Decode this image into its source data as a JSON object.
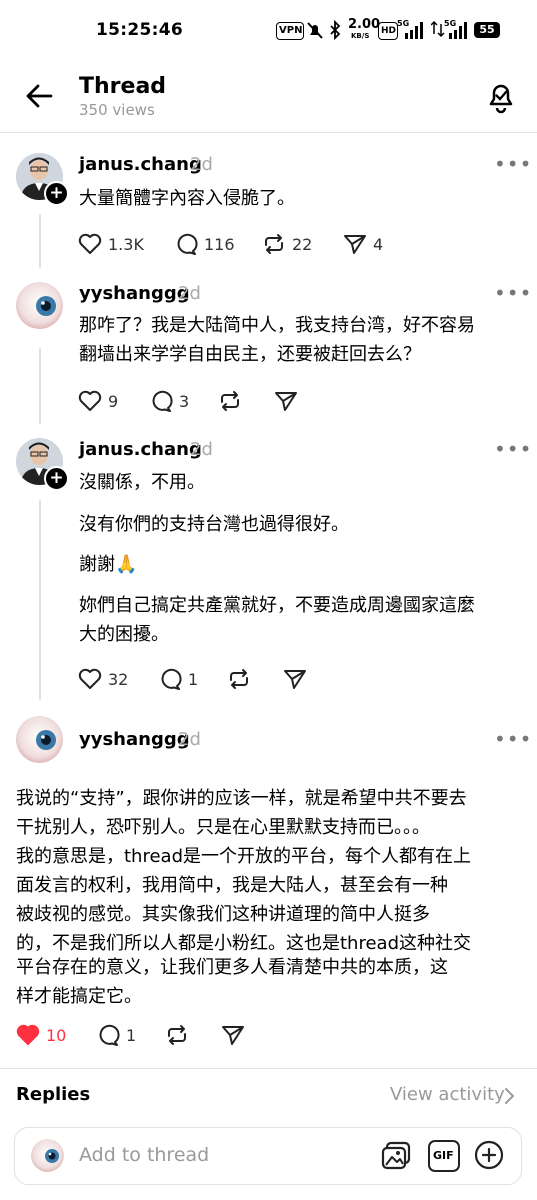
{
  "status_bar": {
    "time": "15:25:46",
    "vpn": "VPN",
    "speed_value": "2.00",
    "speed_unit": "KB/S",
    "hd": "HD",
    "net1": "5G",
    "net2": "5G",
    "battery": "55"
  },
  "header": {
    "title": "Thread",
    "views": "350 views"
  },
  "posts": [
    {
      "username": "janus.chang",
      "age": "2d",
      "lines": [
        "大量簡體字內容入侵脆了。"
      ],
      "likes": "1.3K",
      "comments": "116",
      "reposts": "22",
      "shares": "4"
    },
    {
      "username": "yyshanggg",
      "age": "2d",
      "lines": [
        "那咋了？我是大陆简中人，我支持台湾，好不容易",
        "翻墙出来学学自由民主，还要被赶回去么？"
      ],
      "likes": "9",
      "comments": "3"
    },
    {
      "username": "janus.chang",
      "age": "2d",
      "lines": [
        "沒關係，不用。",
        "沒有你們的支持台灣也過得很好。",
        "謝謝🙏",
        "妳們自己搞定共產黨就好，不要造成周邊國家這麼",
        "大的困擾。"
      ],
      "likes": "32",
      "comments": "1"
    },
    {
      "username": "yyshanggg",
      "age": "2d",
      "lines": [
        "我说的“支持”，跟你讲的应该一样，就是希望中共不要去",
        "干扰别人，恐吓别人。只是在心里默默支持而已。。。",
        "我的意思是，thread是一个开放的平台，每个人都有在上",
        "面发言的权利，我用简中，我是大陆人，甚至会有一种",
        "被歧视的感觉。其实像我们这种讲道理的简中人挺多",
        "的，不是我们所以人都是小粉红。这也是thread这种社交",
        "平台存在的意义，让我们更多人看清楚中共的本质，这",
        "样才能搞定它。"
      ],
      "likes": "10",
      "comments": "1"
    }
  ],
  "replies": {
    "label": "Replies",
    "view_activity": "View activity"
  },
  "composer": {
    "placeholder": "Add to thread",
    "gif_label": "GIF"
  },
  "colors": {
    "heart_liked": "#ff3040",
    "muted": "#999999"
  }
}
